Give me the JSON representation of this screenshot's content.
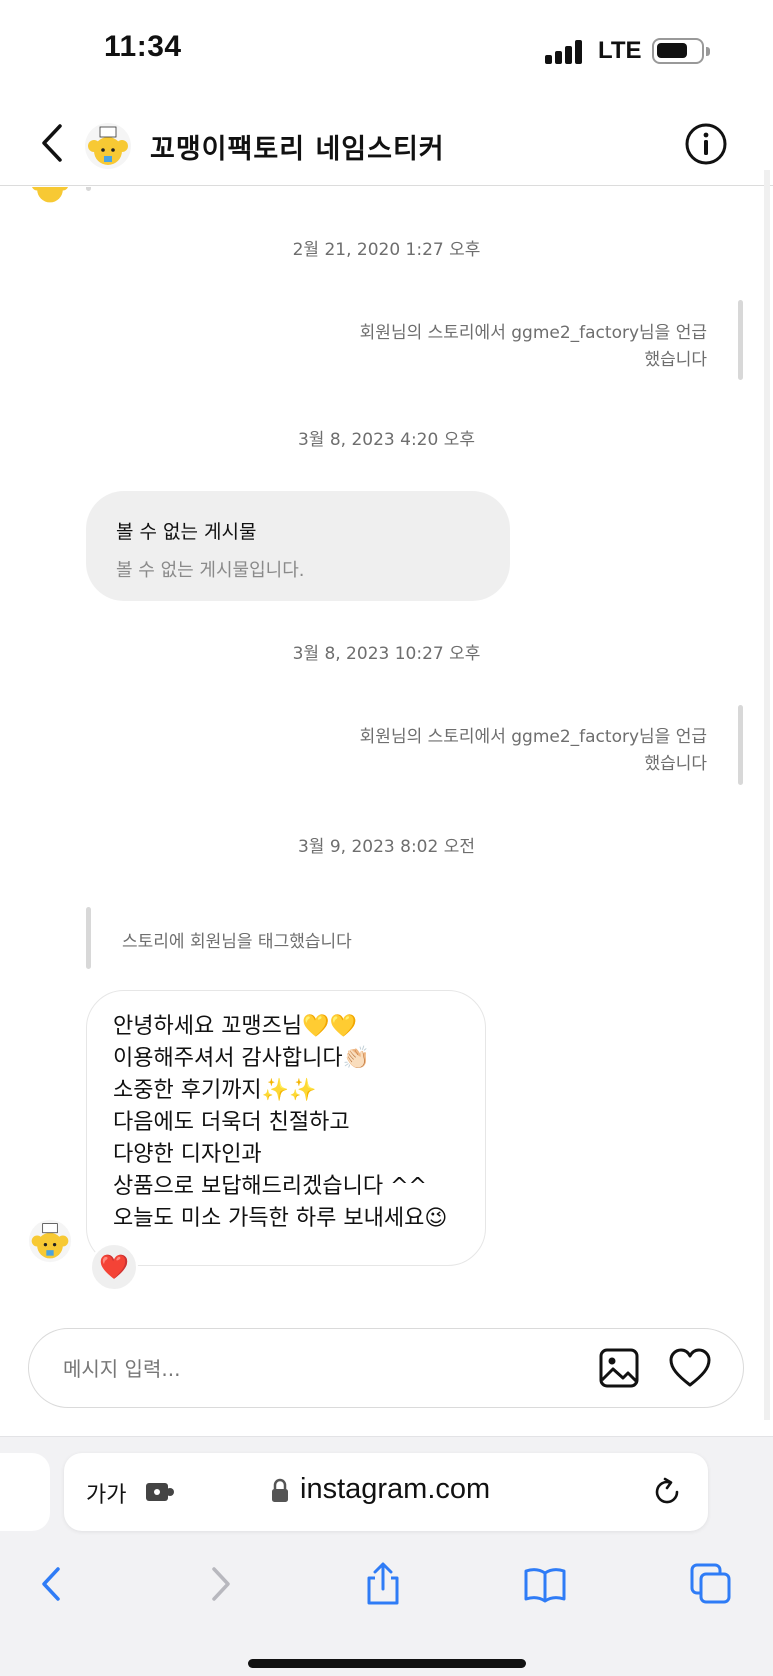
{
  "status_bar": {
    "time": "11:34",
    "network": "LTE",
    "icons": [
      "signal-icon",
      "battery-icon"
    ]
  },
  "header": {
    "title": "꼬맹이팩토리 네임스티커",
    "avatar_text": "ggme2 factory",
    "icons": [
      "back-icon",
      "info-icon"
    ]
  },
  "chat": {
    "timestamps": [
      "2월 21, 2020 1:27 오후",
      "3월 8, 2023 4:20 오후",
      "3월 8, 2023 10:27 오후",
      "3월 9, 2023 8:02 오전"
    ],
    "mention_1": {
      "line1": "회원님의 스토리에서 ggme2_factory님을 언급",
      "line2": "했습니다"
    },
    "post": {
      "title": "볼 수 없는 게시물",
      "subtitle": "볼 수 없는 게시물입니다."
    },
    "mention_2": {
      "line1": "회원님의 스토리에서 ggme2_factory님을 언급",
      "line2": "했습니다"
    },
    "story_tag": "스토리에 회원님을 태그했습니다",
    "message_lines": [
      "안녕하세요 꼬맹즈님💛💛",
      "이용해주셔서 감사합니다👏🏻",
      "소중한 후기까지✨✨",
      "다음에도 더욱더 친절하고",
      "다양한 디자인과",
      "상품으로 보답해드리겠습니다 ^^",
      "오늘도 미소 가득한 하루 보내세요😉"
    ],
    "reaction": "❤️"
  },
  "composer": {
    "placeholder": "메시지 입력...",
    "icons": [
      "gallery-icon",
      "heart-icon"
    ]
  },
  "safari": {
    "aa": "가가",
    "url": "instagram.com",
    "icons": [
      "puzzle-icon",
      "lock-icon",
      "reload-icon",
      "back-arrow-icon",
      "forward-arrow-icon",
      "share-icon",
      "bookmarks-icon",
      "tabs-icon"
    ]
  },
  "colors": {
    "accent": "#2f7cf6",
    "bubble_gray": "#efefef",
    "meta_text": "#6e6e6e"
  }
}
